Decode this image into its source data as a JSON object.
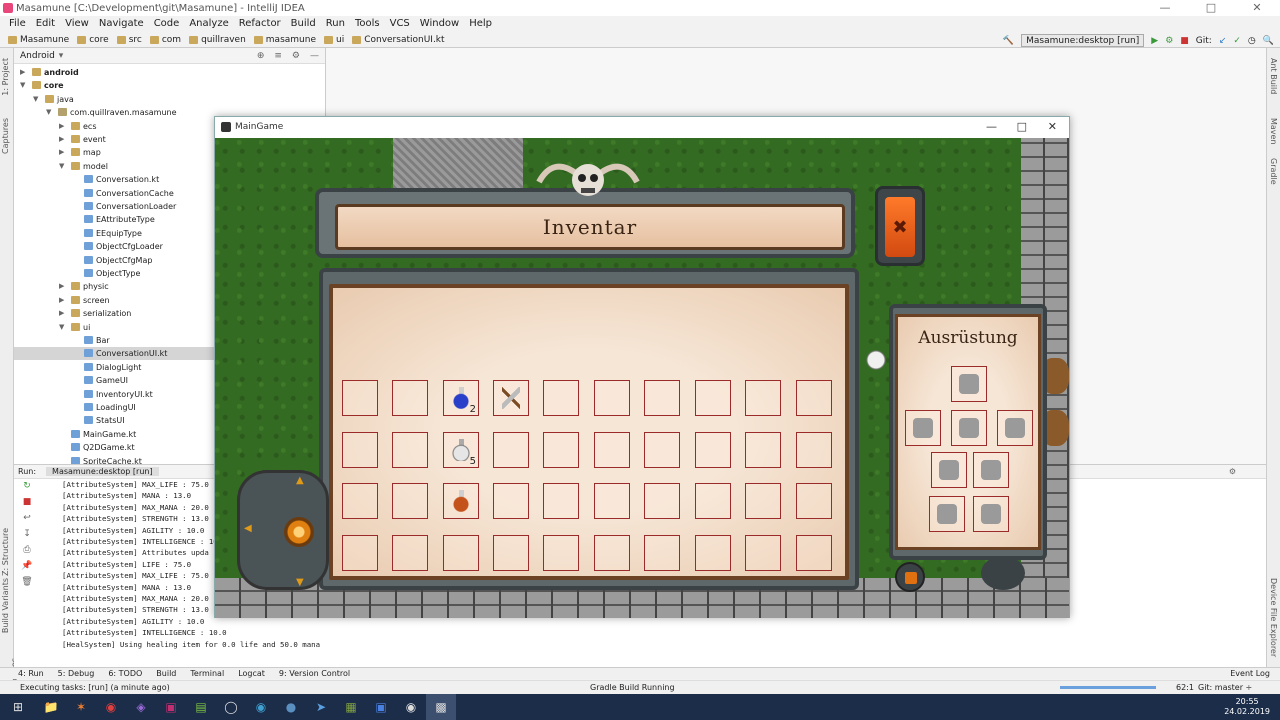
{
  "window_title": "Masamune [C:\\Development\\git\\Masamune] - IntelliJ IDEA",
  "menu": [
    "File",
    "Edit",
    "View",
    "Navigate",
    "Code",
    "Analyze",
    "Refactor",
    "Build",
    "Run",
    "Tools",
    "VCS",
    "Window",
    "Help"
  ],
  "breadcrumbs": [
    "Masamune",
    "core",
    "src",
    "com",
    "quillraven",
    "masamune",
    "ui",
    "ConversationUI.kt"
  ],
  "run_config": "Masamune:desktop [run]",
  "git_label": "Git:",
  "project_panel": {
    "view_label": "Android",
    "tree": [
      {
        "label": "android",
        "indent": 0,
        "type": "folder",
        "arrow": "▶",
        "bold": true
      },
      {
        "label": "core",
        "indent": 0,
        "type": "folder",
        "arrow": "▼",
        "bold": true
      },
      {
        "label": "java",
        "indent": 1,
        "type": "folder",
        "arrow": "▼"
      },
      {
        "label": "com.quillraven.masamune",
        "indent": 2,
        "type": "pkg",
        "arrow": "▼"
      },
      {
        "label": "ecs",
        "indent": 3,
        "type": "folder",
        "arrow": "▶"
      },
      {
        "label": "event",
        "indent": 3,
        "type": "folder",
        "arrow": "▶"
      },
      {
        "label": "map",
        "indent": 3,
        "type": "folder",
        "arrow": "▶"
      },
      {
        "label": "model",
        "indent": 3,
        "type": "folder",
        "arrow": "▼"
      },
      {
        "label": "Conversation.kt",
        "indent": 4,
        "type": "kt"
      },
      {
        "label": "ConversationCache",
        "indent": 4,
        "type": "kt"
      },
      {
        "label": "ConversationLoader",
        "indent": 4,
        "type": "kt"
      },
      {
        "label": "EAttributeType",
        "indent": 4,
        "type": "kt"
      },
      {
        "label": "EEquipType",
        "indent": 4,
        "type": "kt"
      },
      {
        "label": "ObjectCfgLoader",
        "indent": 4,
        "type": "kt"
      },
      {
        "label": "ObjectCfgMap",
        "indent": 4,
        "type": "kt"
      },
      {
        "label": "ObjectType",
        "indent": 4,
        "type": "kt"
      },
      {
        "label": "physic",
        "indent": 3,
        "type": "folder",
        "arrow": "▶"
      },
      {
        "label": "screen",
        "indent": 3,
        "type": "folder",
        "arrow": "▶"
      },
      {
        "label": "serialization",
        "indent": 3,
        "type": "folder",
        "arrow": "▶"
      },
      {
        "label": "ui",
        "indent": 3,
        "type": "folder",
        "arrow": "▼"
      },
      {
        "label": "Bar",
        "indent": 4,
        "type": "kt"
      },
      {
        "label": "ConversationUI.kt",
        "indent": 4,
        "type": "kt",
        "selected": true
      },
      {
        "label": "DialogLight",
        "indent": 4,
        "type": "kt"
      },
      {
        "label": "GameUI",
        "indent": 4,
        "type": "kt"
      },
      {
        "label": "InventoryUI.kt",
        "indent": 4,
        "type": "kt"
      },
      {
        "label": "LoadingUI",
        "indent": 4,
        "type": "kt"
      },
      {
        "label": "StatsUI",
        "indent": 4,
        "type": "kt"
      },
      {
        "label": "MainGame.kt",
        "indent": 3,
        "type": "kt"
      },
      {
        "label": "Q2DGame.kt",
        "indent": 3,
        "type": "kt"
      },
      {
        "label": "SpriteCache.kt",
        "indent": 3,
        "type": "kt"
      }
    ]
  },
  "run_panel": {
    "label": "Run:",
    "tab": "Masamune:desktop [run]",
    "console": [
      "[AttributeSystem] MAX_LIFE : 75.0",
      "[AttributeSystem] MANA : 13.0",
      "[AttributeSystem] MAX_MANA : 20.0",
      "[AttributeSystem] STRENGTH : 13.0",
      "[AttributeSystem] AGILITY : 10.0",
      "[AttributeSystem] INTELLIGENCE : 10.0",
      "[AttributeSystem] Attributes upda",
      "[AttributeSystem] LIFE : 75.0",
      "[AttributeSystem] MAX_LIFE : 75.0",
      "[AttributeSystem] MANA : 13.0",
      "[AttributeSystem] MAX_MANA : 20.0",
      "[AttributeSystem] STRENGTH : 13.0",
      "[AttributeSystem] AGILITY : 10.0",
      "[AttributeSystem] INTELLIGENCE : 10.0",
      "[HealSystem] Using healing item for 0.0 life and 50.0 mana"
    ]
  },
  "bottom_tabs": [
    "4: Run",
    "5: Debug",
    "6: TODO",
    "Build",
    "Terminal",
    "Logcat",
    "9: Version Control"
  ],
  "event_log": "Event Log",
  "status": {
    "left": "Executing tasks: [run] (a minute ago)",
    "center": "Gradle Build Running",
    "position": "62:1",
    "git": "Git: master ÷"
  },
  "left_strip_tabs": [
    "1: Project",
    "Captures",
    "Z: Structure",
    "Build Variants",
    "2: Favorites"
  ],
  "right_strip_tabs": [
    "Ant Build",
    "Maven",
    "Gradle",
    "Device File Explorer"
  ],
  "clock": {
    "time": "20:55",
    "date": "24.02.2019"
  },
  "game": {
    "window_title": "MainGame",
    "inventory_title": "Inventar",
    "equipment_title": "Ausrüstung",
    "close_glyph": "✖",
    "slots": [
      [
        null,
        null,
        {
          "item": "potion-blue",
          "count": "2"
        },
        {
          "item": "sword",
          "count": ""
        },
        null,
        null,
        null,
        null,
        null,
        null
      ],
      [
        null,
        null,
        {
          "item": "potion-white",
          "count": "5"
        },
        null,
        null,
        null,
        null,
        null,
        null,
        null
      ],
      [
        null,
        null,
        {
          "item": "potion-red",
          "count": ""
        },
        null,
        null,
        null,
        null,
        null,
        null,
        null
      ],
      [
        null,
        null,
        null,
        null,
        null,
        null,
        null,
        null,
        null,
        null
      ]
    ],
    "equipment_slots": [
      "helmet-icon",
      "weapon-icon",
      "armor-icon",
      "shield-icon",
      "gloves-icon",
      "boots-icon",
      "amulet-icon",
      "ring-icon"
    ]
  }
}
